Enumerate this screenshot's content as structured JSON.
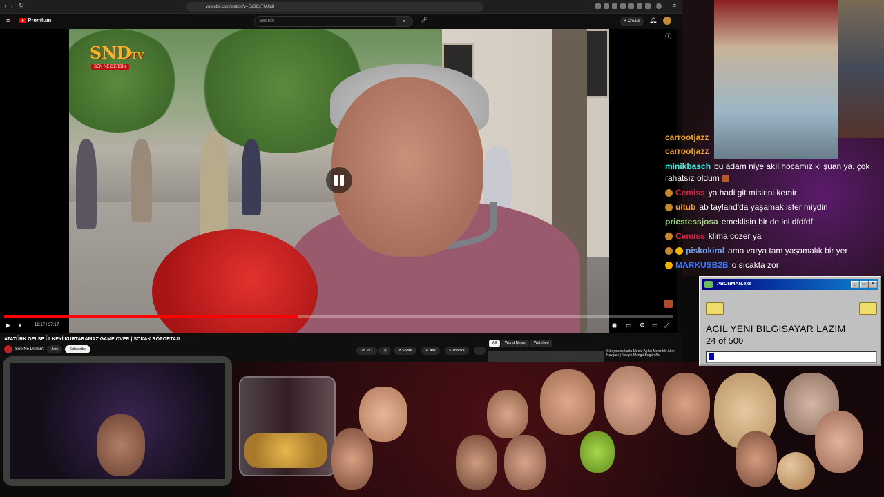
{
  "browser": {
    "url": "youtube.com/watch?v=EvSCsThUsdI"
  },
  "youtube": {
    "logo_text": "Premium",
    "search_placeholder": "Search",
    "create_label": "+ Create",
    "time_display": "16:17 / 37:17",
    "progress_fraction": 0.44,
    "video_title": "ATATÜRK GELSE ÜLKEYİ KURTARAMAZ GAME OVER | SOKAK RÖPORTAJI",
    "channel_name": "Sen Ne Dersin?",
    "join_label": "Join",
    "subscribe_label": "Subscribe",
    "like_count": "211",
    "share_label": "Share",
    "ask_label": "Ask",
    "thanks_label": "Thanks",
    "more_label": "...",
    "chips": [
      "All",
      "World News",
      "Watched"
    ],
    "rec_title": "Süleymancılarda Mezar Açıldı Menzilde Altın Kavgası | Nevşin Mengü Bugün Ne",
    "overlay_logo": "SND",
    "overlay_logo_tv": "TV",
    "overlay_sub": "SEN NE DERSİN"
  },
  "chat": [
    {
      "user": "carrootjazz",
      "color": "#f0a32a",
      "text": ""
    },
    {
      "user": "carrootjazz",
      "color": "#f0a32a",
      "text": ""
    },
    {
      "user": "minikbasch",
      "color": "#3ff2e6",
      "text": "bu adam niye akıl hocamız ki şuan ya. çok"
    },
    {
      "user": "",
      "color": "#ffffff",
      "text": "rahatsız oldum"
    },
    {
      "user": "Cemiss",
      "color": "#e02046",
      "text": "ya hadi git misirini kemir"
    },
    {
      "user": "ultub",
      "color": "#f0a32a",
      "text": "ab tayland'da yaşamak ister miydin"
    },
    {
      "user": "priestessjosa",
      "color": "#9ed87a",
      "text": "emeklisin bir de lol dfdfdf"
    },
    {
      "user": "Cemiss",
      "color": "#e02046",
      "text": "klima cozer ya"
    },
    {
      "user": "piskokiral",
      "color": "#6ea4ff",
      "text": "ama varya tam yaşamalık bir yer"
    },
    {
      "user": "MARKUSB2B",
      "color": "#3d7bff",
      "text": "o sıcakta zor"
    }
  ],
  "popup": {
    "title": "ABONMAN.exe",
    "message": "ACIL YENI BILGISAYAR LAZIM",
    "count_text": "24 of 500",
    "progress_fraction": 0.048,
    "btn_min": "_",
    "btn_max": "□",
    "btn_close": "×"
  }
}
